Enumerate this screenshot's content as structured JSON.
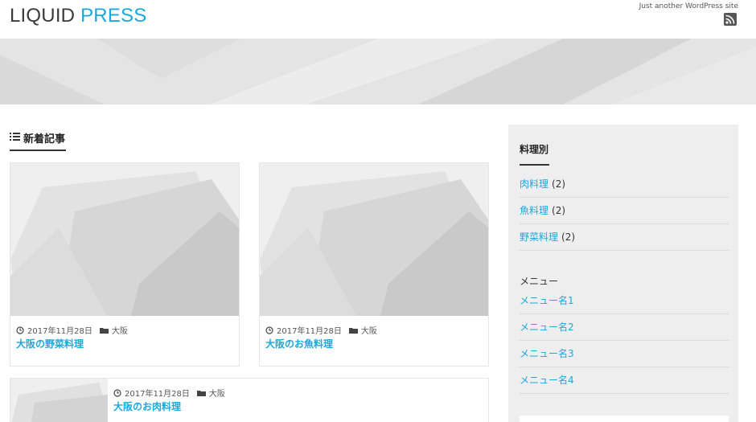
{
  "header": {
    "logo_part1": "LIQUID",
    "logo_part2": "PRESS",
    "tagline": "Just another WordPress site"
  },
  "icons": {
    "rss": "rss-icon",
    "list": "list-icon",
    "clock": "clock-icon",
    "folder": "folder-icon"
  },
  "colors": {
    "accent": "#1aa8dd",
    "banner": "#e3e3e3",
    "sidebar_bg": "#eeeeee"
  },
  "main": {
    "section_title": "新着記事",
    "posts": [
      {
        "date": "2017年11月28日",
        "category": "大阪",
        "title": "大阪の野菜料理"
      },
      {
        "date": "2017年11月28日",
        "category": "大阪",
        "title": "大阪のお魚料理"
      },
      {
        "date": "2017年11月28日",
        "category": "大阪",
        "title": "大阪のお肉料理"
      }
    ]
  },
  "sidebar": {
    "widget_title": "料理別",
    "categories": [
      {
        "label": "肉料理",
        "count": "(2)"
      },
      {
        "label": "魚料理",
        "count": "(2)"
      },
      {
        "label": "野菜料理",
        "count": "(2)"
      }
    ],
    "menu_heading": "メニュー",
    "menu_items": [
      "メニュー名1",
      "メニュー名2",
      "メニュー名3",
      "メニュー名4"
    ]
  }
}
